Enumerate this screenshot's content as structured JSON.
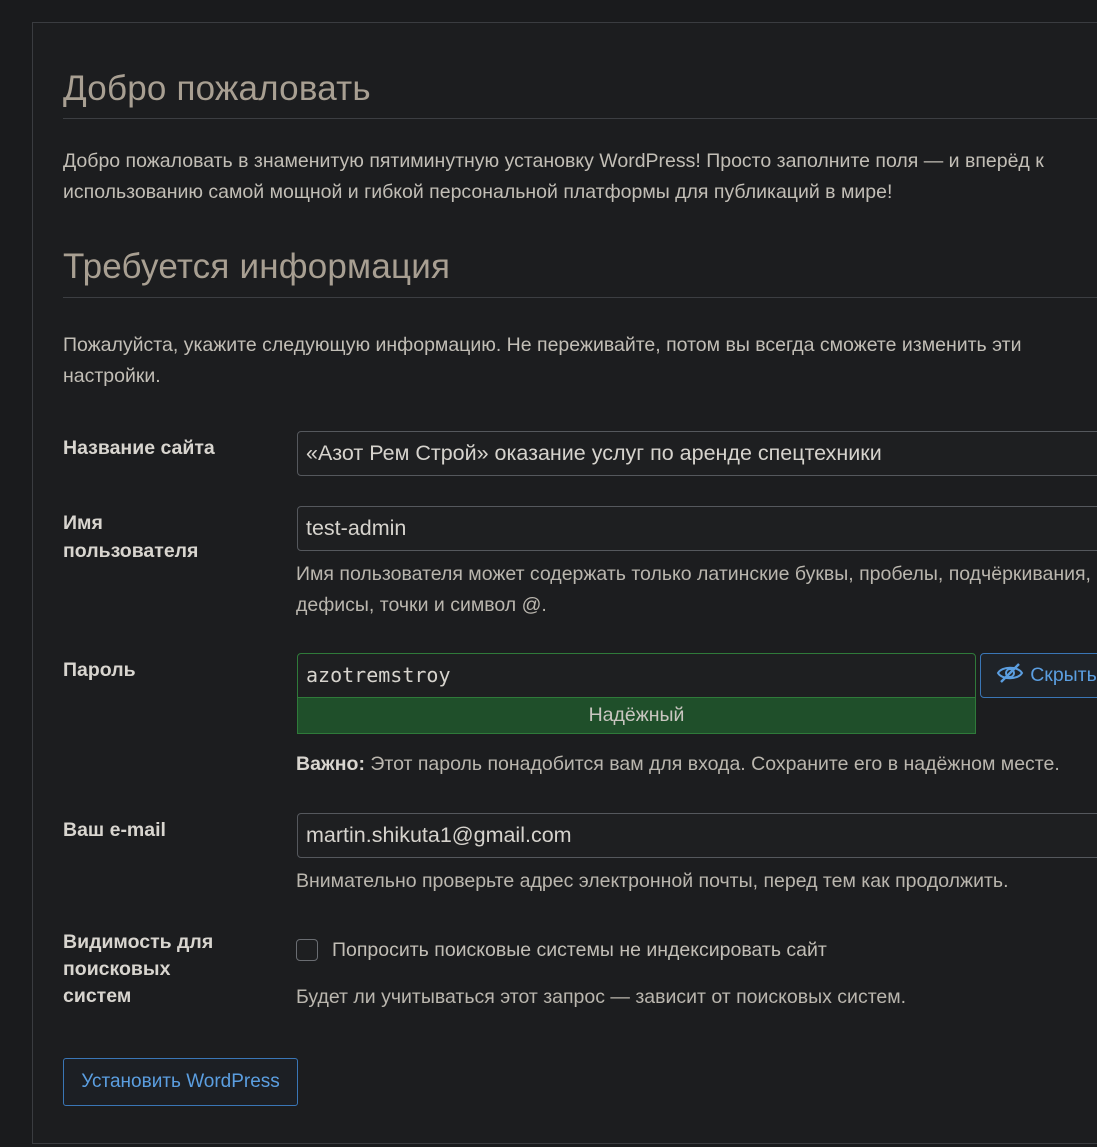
{
  "welcome": {
    "title": "Добро пожаловать",
    "text": "Добро пожаловать в знаменитую пятиминутную установку WordPress! Просто заполните поля — и вперёд к использованию самой мощной и гибкой персональной платформы для публикаций в мире!"
  },
  "info": {
    "title": "Требуется информация",
    "text": "Пожалуйста, укажите следующую информацию. Не переживайте, потом вы всегда сможете изменить эти настройки."
  },
  "form": {
    "site_title": {
      "label": "Название сайта",
      "value": "«Азот Рем Строй» оказание услуг по аренде спецтехники"
    },
    "username": {
      "label": "Имя пользователя",
      "value": "test-admin",
      "hint": "Имя пользователя может содержать только латинские буквы, пробелы, подчёркивания, дефисы, точки и символ @."
    },
    "password": {
      "label": "Пароль",
      "value": "azotremstroy",
      "strength": "Надёжный",
      "hide_button": "Скрыть",
      "hint_bold": "Важно:",
      "hint": " Этот пароль понадобится вам для входа. Сохраните его в надёжном месте."
    },
    "email": {
      "label": "Ваш e-mail",
      "value": "martin.shikuta1@gmail.com",
      "hint": "Внимательно проверьте адрес электронной почты, перед тем как продолжить."
    },
    "visibility": {
      "label": "Видимость для поисковых систем",
      "checkbox_label": "Попросить поисковые системы не индексировать сайт",
      "checked": false,
      "hint": "Будет ли учитываться этот запрос — зависит от поисковых систем."
    },
    "submit_label": "Установить WordPress"
  },
  "colors": {
    "accent": "#5b9ee0",
    "strength_bg": "#1f4f2a",
    "heading": "#a89f92"
  }
}
